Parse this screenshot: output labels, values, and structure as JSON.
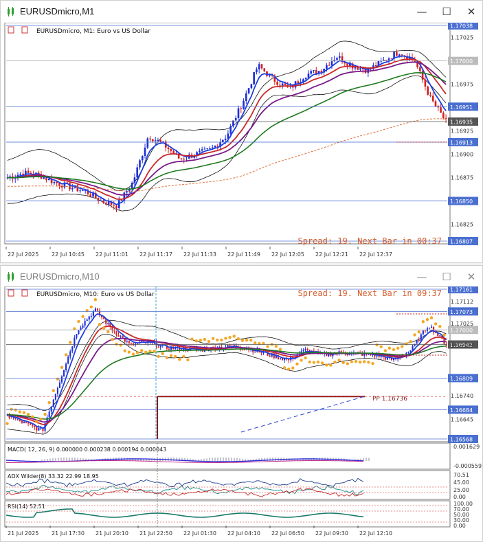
{
  "window1": {
    "title": "EURUSDmicro,M1",
    "chart_header": "EURUSDmicro, M1:  Euro vs US Dollar",
    "spread_text": "Spread: 19. Next Bar in 00:37",
    "buttons": {
      "minimize": "—",
      "maximize": "☐",
      "close": "✕"
    },
    "price_ticks": [
      "1.17025",
      "1.16975",
      "1.16925",
      "1.16900",
      "1.16875",
      "1.16825"
    ],
    "price_boxes": [
      {
        "label": "1.17038",
        "style": "blue"
      },
      {
        "label": "1.17000",
        "style": "gray"
      },
      {
        "label": "1.16951",
        "style": "blue"
      },
      {
        "label": "1.16935",
        "style": "dark"
      },
      {
        "label": "1.16913",
        "style": "blue"
      },
      {
        "label": "1.16850",
        "style": "blue"
      },
      {
        "label": "1.16807",
        "style": "blue"
      }
    ],
    "time_labels": [
      "22 Jul 2025",
      "22 Jul 10:45",
      "22 Jul 11:01",
      "22 Jul 11:17",
      "22 Jul 11:33",
      "22 Jul 11:49",
      "22 Jul 12:05",
      "22 Jul 12:21",
      "22 Jul 12:37"
    ]
  },
  "window2": {
    "title": "EURUSDmicro,M10",
    "chart_header": "EURUSDmicro, M10:  Euro vs US Dollar",
    "spread_text": "Spread: 19. Next Bar in 09:37",
    "buttons": {
      "minimize": "—",
      "maximize": "☐",
      "close": "✕"
    },
    "pivot_label": "PP 1.16736",
    "price_ticks": [
      "1.17112",
      "1.17025",
      "1.16938",
      "1.16740",
      "1.16645"
    ],
    "price_boxes": [
      {
        "label": "1.17161",
        "style": "blue"
      },
      {
        "label": "1.17073",
        "style": "blue"
      },
      {
        "label": "1.17000",
        "style": "gray"
      },
      {
        "label": "1.16942",
        "style": "dark"
      },
      {
        "label": "1.16809",
        "style": "blue"
      },
      {
        "label": "1.16684",
        "style": "blue"
      },
      {
        "label": "1.16568",
        "style": "blue"
      }
    ],
    "macd": {
      "label": "MACD( 12, 26, 9)  0.000000  0.000238  0.000194  0.000043",
      "ticks": [
        "0.001629",
        "-0.000559"
      ]
    },
    "adx": {
      "label": "ADX Wilder(8) 33.32 22.99 18.95",
      "ticks": [
        "70.51",
        "45.00",
        "25.00",
        "0.00"
      ]
    },
    "rsi": {
      "label": "RSI(14) 52.51",
      "ticks": [
        "100.00",
        "70.00",
        "50.00",
        "30.00",
        "0.00"
      ]
    },
    "time_labels": [
      "21 Jul 2025",
      "21 Jul 17:30",
      "21 Jul 20:10",
      "21 Jul 22:50",
      "22 Jul 01:30",
      "22 Jul 04:10",
      "22 Jul 06:50",
      "22 Jul 09:30",
      "22 Jul 12:10"
    ]
  },
  "colors": {
    "bull": "#1e2fd8",
    "bear": "#d41f1f",
    "ma_fast": "#1e3fe0",
    "ma_red": "#d42020",
    "ma_purple": "#7a1a8a",
    "ma_green": "#1f7a1f",
    "bollinger": "#111111",
    "sar": "#f5a623",
    "hline": "#4a6fd0"
  },
  "chart_data": [
    {
      "type": "candlestick",
      "title": "EURUSDmicro, M1: Euro vs US Dollar",
      "timeframe": "M1",
      "ylim": [
        1.16807,
        1.17038
      ],
      "x": [
        "22 Jul 2025",
        "22 Jul 10:45",
        "22 Jul 11:01",
        "22 Jul 11:17",
        "22 Jul 11:33",
        "22 Jul 11:49",
        "22 Jul 12:05",
        "22 Jul 12:21",
        "22 Jul 12:37"
      ],
      "close_path": [
        1.16875,
        1.1688,
        1.16878,
        1.1687,
        1.16865,
        1.1686,
        1.1685,
        1.16845,
        1.1687,
        1.1692,
        1.1691,
        1.16895,
        1.169,
        1.16905,
        1.1692,
        1.16955,
        1.16995,
        1.1698,
        1.1697,
        1.16985,
        1.1699,
        1.17005,
        1.16995,
        1.1699,
        1.17,
        1.1701,
        1.17,
        1.1696,
        1.16935
      ],
      "horizontal_levels": [
        1.17038,
        1.17,
        1.16951,
        1.16935,
        1.16913,
        1.1685,
        1.16807
      ],
      "current_price": 1.16935
    },
    {
      "type": "candlestick",
      "title": "EURUSDmicro, M10: Euro vs US Dollar",
      "timeframe": "M10",
      "ylim": [
        1.16568,
        1.17161
      ],
      "x": [
        "21 Jul 2025",
        "21 Jul 17:30",
        "21 Jul 20:10",
        "21 Jul 22:50",
        "22 Jul 01:30",
        "22 Jul 04:10",
        "22 Jul 06:50",
        "22 Jul 09:30",
        "22 Jul 12:10"
      ],
      "close_path": [
        1.1666,
        1.1663,
        1.166,
        1.168,
        1.17,
        1.1708,
        1.17,
        1.1694,
        1.1695,
        1.1693,
        1.16925,
        1.1692,
        1.1693,
        1.16935,
        1.1692,
        1.169,
        1.1688,
        1.1692,
        1.169,
        1.1691,
        1.16905,
        1.169,
        1.1688,
        1.1692,
        1.1702,
        1.16942
      ],
      "horizontal_levels": [
        1.17161,
        1.17073,
        1.17,
        1.16942,
        1.16809,
        1.16684,
        1.16568
      ],
      "pivot_pp": 1.16736,
      "current_price": 1.16942
    }
  ]
}
